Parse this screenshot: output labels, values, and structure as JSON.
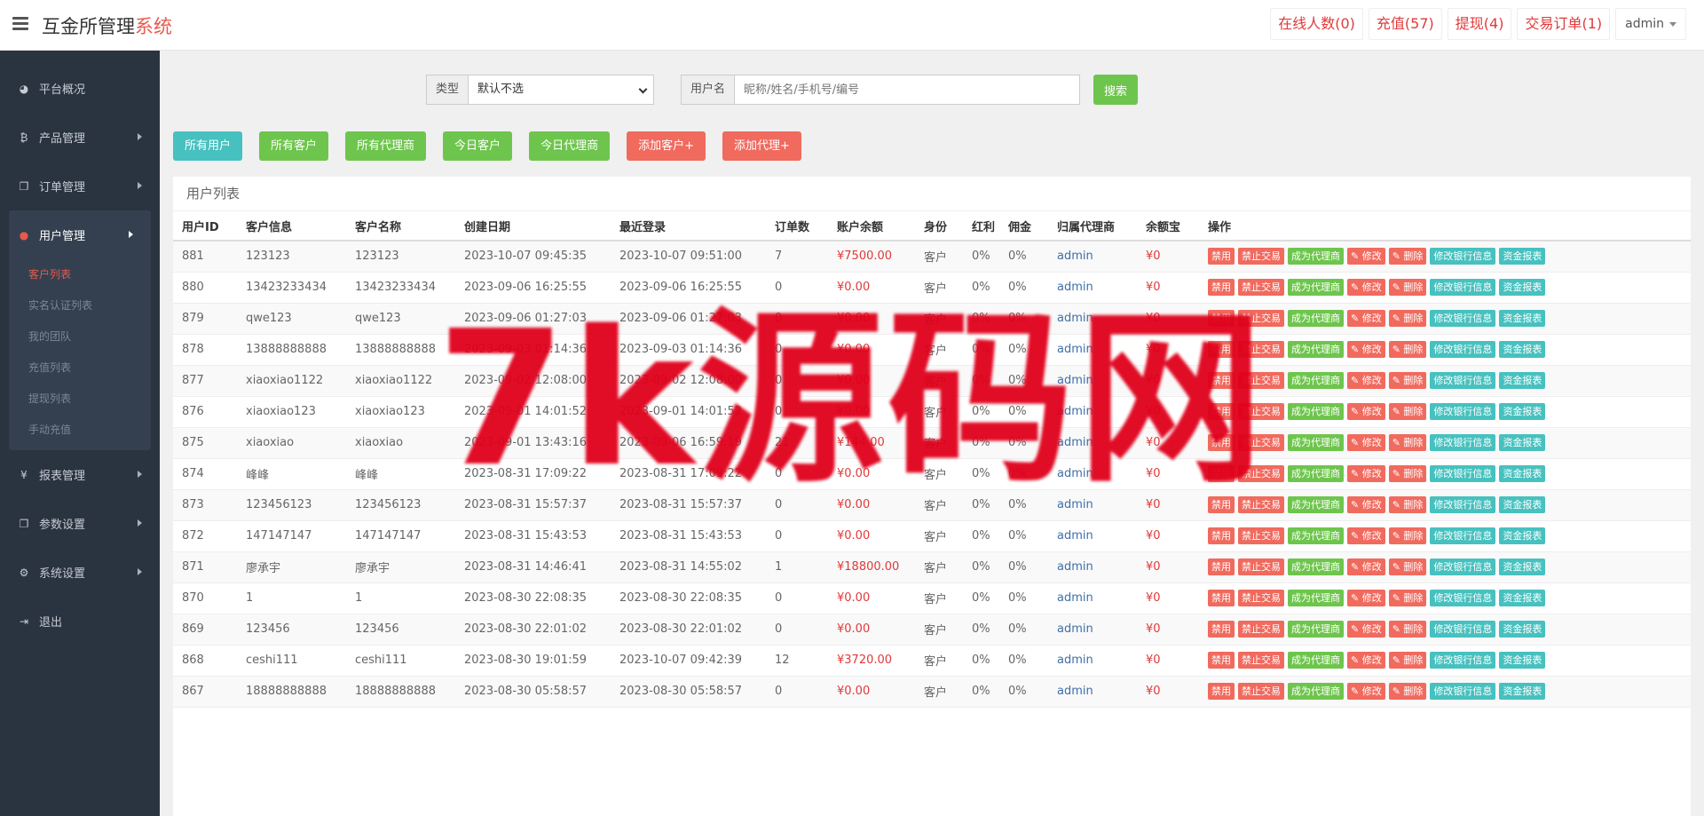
{
  "header": {
    "brand_main": "互金所管理",
    "brand_accent": "系统",
    "nav": [
      "在线人数(0)",
      "充值(57)",
      "提现(4)",
      "交易订单(1)"
    ],
    "user": "admin"
  },
  "sidebar": {
    "items": [
      {
        "label": "平台概况",
        "icon": "dashboard-icon"
      },
      {
        "label": "产品管理",
        "icon": "bitcoin-icon"
      },
      {
        "label": "订单管理",
        "icon": "copy-icon"
      },
      {
        "label": "用户管理",
        "icon": "user-icon"
      },
      {
        "label": "报表管理",
        "icon": "yen-icon"
      },
      {
        "label": "参数设置",
        "icon": "copy-icon"
      },
      {
        "label": "系统设置",
        "icon": "cogs-icon"
      },
      {
        "label": "退出",
        "icon": "sign-out-icon"
      }
    ],
    "submenu": [
      "客户列表",
      "实名认证列表",
      "我的团队",
      "充值列表",
      "提现列表",
      "手动充值"
    ]
  },
  "search": {
    "type_label": "类型",
    "type_value": "默认不选",
    "user_label": "用户名",
    "user_placeholder": "昵称/姓名/手机号/编号",
    "search_button": "搜索"
  },
  "filters": [
    "所有用户",
    "所有客户",
    "所有代理商",
    "今日客户",
    "今日代理商",
    "添加客户+",
    "添加代理+"
  ],
  "table": {
    "title": "用户列表",
    "headers": [
      "用户ID",
      "客户信息",
      "客户名称",
      "创建日期",
      "最近登录",
      "订单数",
      "账户余额",
      "身份",
      "红利",
      "佣金",
      "归属代理商",
      "余额宝",
      "操作"
    ],
    "actions": [
      "禁用",
      "禁止交易",
      "成为代理商",
      "✎ 修改",
      "✎ 删除",
      "修改银行信息",
      "资金报表"
    ],
    "rows": [
      [
        "881",
        "123123",
        "123123",
        "2023-10-07 09:45:35",
        "2023-10-07 09:51:00",
        "7",
        "¥7500.00",
        "客户",
        "0%",
        "0%",
        "admin",
        "¥0"
      ],
      [
        "880",
        "13423233434",
        "13423233434",
        "2023-09-06 16:25:55",
        "2023-09-06 16:25:55",
        "0",
        "¥0.00",
        "客户",
        "0%",
        "0%",
        "admin",
        "¥0"
      ],
      [
        "879",
        "qwe123",
        "qwe123",
        "2023-09-06 01:27:03",
        "2023-09-06 01:27:03",
        "0",
        "¥0.00",
        "客户",
        "0%",
        "0%",
        "admin",
        "¥0"
      ],
      [
        "878",
        "13888888888",
        "13888888888",
        "2023-09-03 01:14:36",
        "2023-09-03 01:14:36",
        "0",
        "¥0.00",
        "客户",
        "0%",
        "0%",
        "admin",
        "¥0"
      ],
      [
        "877",
        "xiaoxiao1122",
        "xiaoxiao1122",
        "2023-09-02 12:08:00",
        "2023-09-02 12:08:00",
        "0",
        "¥0.00",
        "客户",
        "0%",
        "0%",
        "admin",
        "¥0"
      ],
      [
        "876",
        "xiaoxiao123",
        "xiaoxiao123",
        "2023-09-01 14:01:52",
        "2023-09-01 14:01:52",
        "0",
        "¥0.00",
        "客户",
        "0%",
        "0%",
        "admin",
        "¥0"
      ],
      [
        "875",
        "xiaoxiao",
        "xiaoxiao",
        "2023-09-01 13:43:16",
        "2023-09-06 16:59:19",
        "21",
        "¥144.00",
        "客户",
        "0%",
        "0%",
        "admin",
        "¥0"
      ],
      [
        "874",
        "峰峰",
        "峰峰",
        "2023-08-31 17:09:22",
        "2023-08-31 17:09:22",
        "0",
        "¥0.00",
        "客户",
        "0%",
        "0%",
        "admin",
        "¥0"
      ],
      [
        "873",
        "123456123",
        "123456123",
        "2023-08-31 15:57:37",
        "2023-08-31 15:57:37",
        "0",
        "¥0.00",
        "客户",
        "0%",
        "0%",
        "admin",
        "¥0"
      ],
      [
        "872",
        "147147147",
        "147147147",
        "2023-08-31 15:43:53",
        "2023-08-31 15:43:53",
        "0",
        "¥0.00",
        "客户",
        "0%",
        "0%",
        "admin",
        "¥0"
      ],
      [
        "871",
        "廖承宇",
        "廖承宇",
        "2023-08-31 14:46:41",
        "2023-08-31 14:55:02",
        "1",
        "¥18800.00",
        "客户",
        "0%",
        "0%",
        "admin",
        "¥0"
      ],
      [
        "870",
        "1",
        "1",
        "2023-08-30 22:08:35",
        "2023-08-30 22:08:35",
        "0",
        "¥0.00",
        "客户",
        "0%",
        "0%",
        "admin",
        "¥0"
      ],
      [
        "869",
        "123456",
        "123456",
        "2023-08-30 22:01:02",
        "2023-08-30 22:01:02",
        "0",
        "¥0.00",
        "客户",
        "0%",
        "0%",
        "admin",
        "¥0"
      ],
      [
        "868",
        "ceshi111",
        "ceshi111",
        "2023-08-30 19:01:59",
        "2023-10-07 09:42:39",
        "12",
        "¥3720.00",
        "客户",
        "0%",
        "0%",
        "admin",
        "¥0"
      ],
      [
        "867",
        "18888888888",
        "18888888888",
        "2023-08-30 05:58:57",
        "2023-08-30 05:58:57",
        "0",
        "¥0.00",
        "客户",
        "0%",
        "0%",
        "admin",
        "¥0"
      ]
    ]
  },
  "watermark": "7k源码网",
  "colors": {
    "sidebar_bg": "#2a3340",
    "accent_red": "#e8594d",
    "green": "#6ec54d",
    "teal": "#47c1bf",
    "agent_blue": "#3e6fa8"
  }
}
